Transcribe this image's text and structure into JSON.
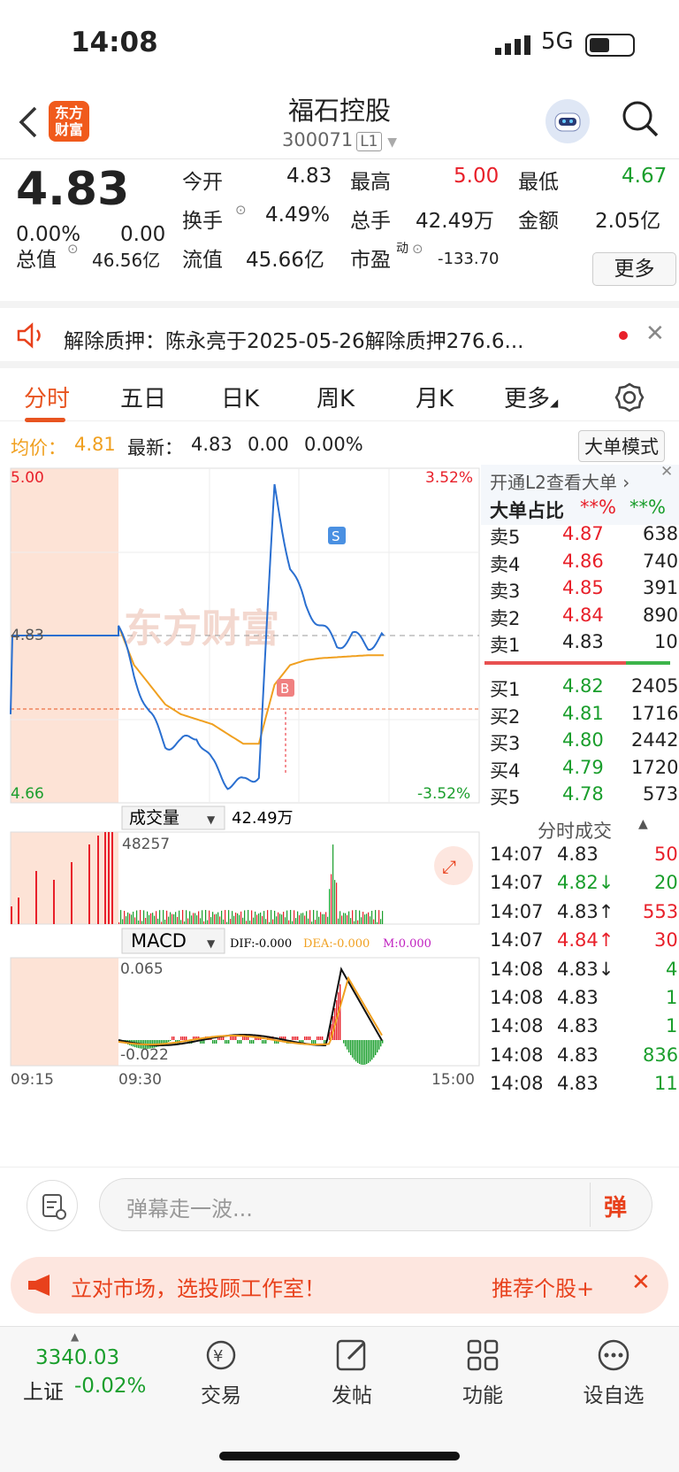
{
  "status": {
    "time": "14:08",
    "network": "5G"
  },
  "header": {
    "name": "福石控股",
    "code": "300071",
    "level": "L1",
    "logo_line1": "东方",
    "logo_line2": "财富"
  },
  "quote": {
    "price": "4.83",
    "change_pct": "0.00%",
    "change": "0.00",
    "open_label": "今开",
    "open": "4.83",
    "high_label": "最高",
    "high": "5.00",
    "low_label": "最低",
    "low": "4.67",
    "turnover_label": "换手",
    "turnover": "4.49%",
    "volume_label": "总手",
    "volume": "42.49万",
    "amount_label": "金额",
    "amount": "2.05亿",
    "mcap_label": "总值",
    "mcap": "46.56亿",
    "float_label": "流值",
    "float": "45.66亿",
    "pe_label": "市盈",
    "pe_sup": "动",
    "pe": "-133.70",
    "more": "更多"
  },
  "news": {
    "text": "解除质押：陈永亮于2025-05-26解除质押276.6..."
  },
  "tabs": [
    "分时",
    "五日",
    "日K",
    "周K",
    "月K",
    "更多"
  ],
  "infobar": {
    "avg_label": "均价：",
    "avg": "4.81",
    "latest_label": "最新：",
    "latest": "4.83",
    "chg": "0.00",
    "chg_pct": "0.00%",
    "mode_btn": "大单模式"
  },
  "chart": {
    "ymax": "5.00",
    "ymin": "4.66",
    "pct_max": "3.52%",
    "pct_min": "-3.52%",
    "mid": "4.83",
    "t_start": "09:15",
    "t_open": "09:30",
    "t_end": "15:00",
    "buy_mark": "B",
    "sell_mark": "S",
    "watermark": "东方财富"
  },
  "volume": {
    "label": "成交量",
    "total": "42.49万",
    "max": "48257"
  },
  "macd": {
    "label": "MACD",
    "dif": "DIF:-0.000",
    "dea": "DEA:-0.000",
    "m": "M:0.000",
    "top": "0.065",
    "bottom": "-0.022"
  },
  "chart_data": {
    "type": "line",
    "title": "分时",
    "ylim": [
      4.66,
      5.0
    ],
    "prev_close": 4.83,
    "x": [
      "09:30",
      "09:35",
      "09:45",
      "10:00",
      "10:15",
      "10:30",
      "10:45",
      "11:00",
      "11:15",
      "11:30",
      "13:05",
      "13:10",
      "13:20",
      "13:30",
      "13:40",
      "13:50",
      "14:00",
      "14:08"
    ],
    "series": [
      {
        "name": "最新",
        "values": [
          4.84,
          4.79,
          4.75,
          4.72,
          4.72,
          4.73,
          4.7,
          4.68,
          4.68,
          4.69,
          4.98,
          4.9,
          4.86,
          4.84,
          4.82,
          4.83,
          4.82,
          4.83
        ]
      },
      {
        "name": "均价",
        "values": [
          4.84,
          4.8,
          4.78,
          4.76,
          4.75,
          4.745,
          4.74,
          4.73,
          4.72,
          4.72,
          4.78,
          4.8,
          4.805,
          4.807,
          4.808,
          4.809,
          4.81,
          4.81
        ]
      }
    ]
  },
  "orderbook": {
    "l2": "开通L2查看大单",
    "ratio_label": "大单占比",
    "ratio_a": "**%",
    "ratio_b": "**%",
    "asks": [
      {
        "l": "卖5",
        "p": "4.87",
        "v": "638"
      },
      {
        "l": "卖4",
        "p": "4.86",
        "v": "740"
      },
      {
        "l": "卖3",
        "p": "4.85",
        "v": "391"
      },
      {
        "l": "卖2",
        "p": "4.84",
        "v": "890"
      },
      {
        "l": "卖1",
        "p": "4.83",
        "v": "10"
      }
    ],
    "bids": [
      {
        "l": "买1",
        "p": "4.82",
        "v": "2405"
      },
      {
        "l": "买2",
        "p": "4.81",
        "v": "1716"
      },
      {
        "l": "买3",
        "p": "4.80",
        "v": "2442"
      },
      {
        "l": "买4",
        "p": "4.79",
        "v": "1720"
      },
      {
        "l": "买5",
        "p": "4.78",
        "v": "573"
      }
    ],
    "ticks_label": "分时成交",
    "ticks": [
      {
        "t": "14:07",
        "p": "4.83",
        "v": "50",
        "pc": "#222",
        "vc": "#e8202a"
      },
      {
        "t": "14:07",
        "p": "4.82↓",
        "v": "20",
        "pc": "#1a9e2c",
        "vc": "#1a9e2c"
      },
      {
        "t": "14:07",
        "p": "4.83↑",
        "v": "553",
        "pc": "#222",
        "vc": "#e8202a"
      },
      {
        "t": "14:07",
        "p": "4.84↑",
        "v": "30",
        "pc": "#e8202a",
        "vc": "#e8202a"
      },
      {
        "t": "14:08",
        "p": "4.83↓",
        "v": "4",
        "pc": "#222",
        "vc": "#1a9e2c"
      },
      {
        "t": "14:08",
        "p": "4.83",
        "v": "1",
        "pc": "#222",
        "vc": "#1a9e2c"
      },
      {
        "t": "14:08",
        "p": "4.83",
        "v": "1",
        "pc": "#222",
        "vc": "#1a9e2c"
      },
      {
        "t": "14:08",
        "p": "4.83",
        "v": "836",
        "pc": "#222",
        "vc": "#1a9e2c"
      },
      {
        "t": "14:08",
        "p": "4.83",
        "v": "11",
        "pc": "#222",
        "vc": "#1a9e2c"
      }
    ]
  },
  "comment": {
    "placeholder": "弹幕走一波...",
    "btn": "弹"
  },
  "banner": {
    "text": "立对市场，选投顾工作室！",
    "right": "推荐个股+"
  },
  "tabbar": {
    "index_value": "3340.03",
    "index_name": "上证",
    "index_pct": "-0.02%",
    "trade": "交易",
    "post": "发帖",
    "func": "功能",
    "fav": "设自选"
  }
}
